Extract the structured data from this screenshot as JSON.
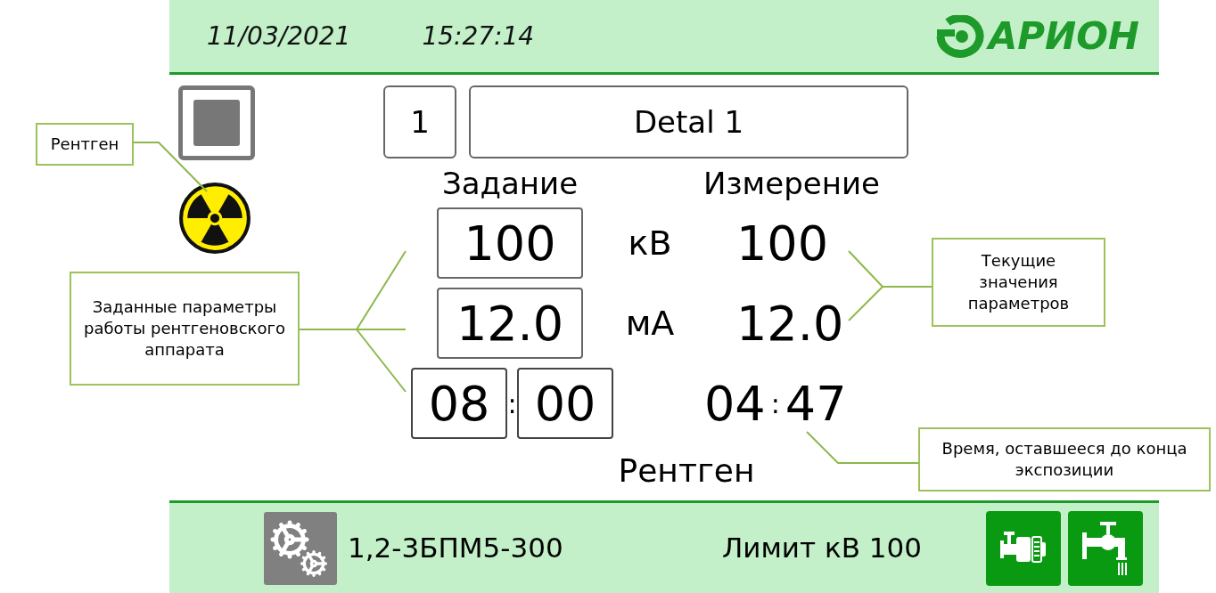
{
  "header": {
    "date": "11/03/2021",
    "time": "15:27:14",
    "logo": "АРИОН"
  },
  "program": {
    "number": "1",
    "name": "Detal 1"
  },
  "columns": [
    "Задание",
    "Измерение"
  ],
  "parameters": [
    {
      "setpoint": "100",
      "unit": "кВ",
      "measured": "100"
    },
    {
      "setpoint": "12.0",
      "unit": "мА",
      "measured": "12.0"
    }
  ],
  "exposure": {
    "set_minutes": "08",
    "set_separator": ":",
    "set_seconds": "00",
    "remaining_minutes": "04",
    "remaining_separator": ":",
    "remaining_seconds": "47"
  },
  "mode_label": "Рентген",
  "footer": {
    "tube": "1,2-3БПМ5-300",
    "limit": "Лимит кВ 100"
  },
  "callouts": [
    {
      "text": "Рентген"
    },
    {
      "text": "Заданные параметры работы рентгеновского аппарата"
    },
    {
      "text": "Текущие значения параметров"
    },
    {
      "text": "Время, оставшееся до конца экспозиции"
    }
  ]
}
